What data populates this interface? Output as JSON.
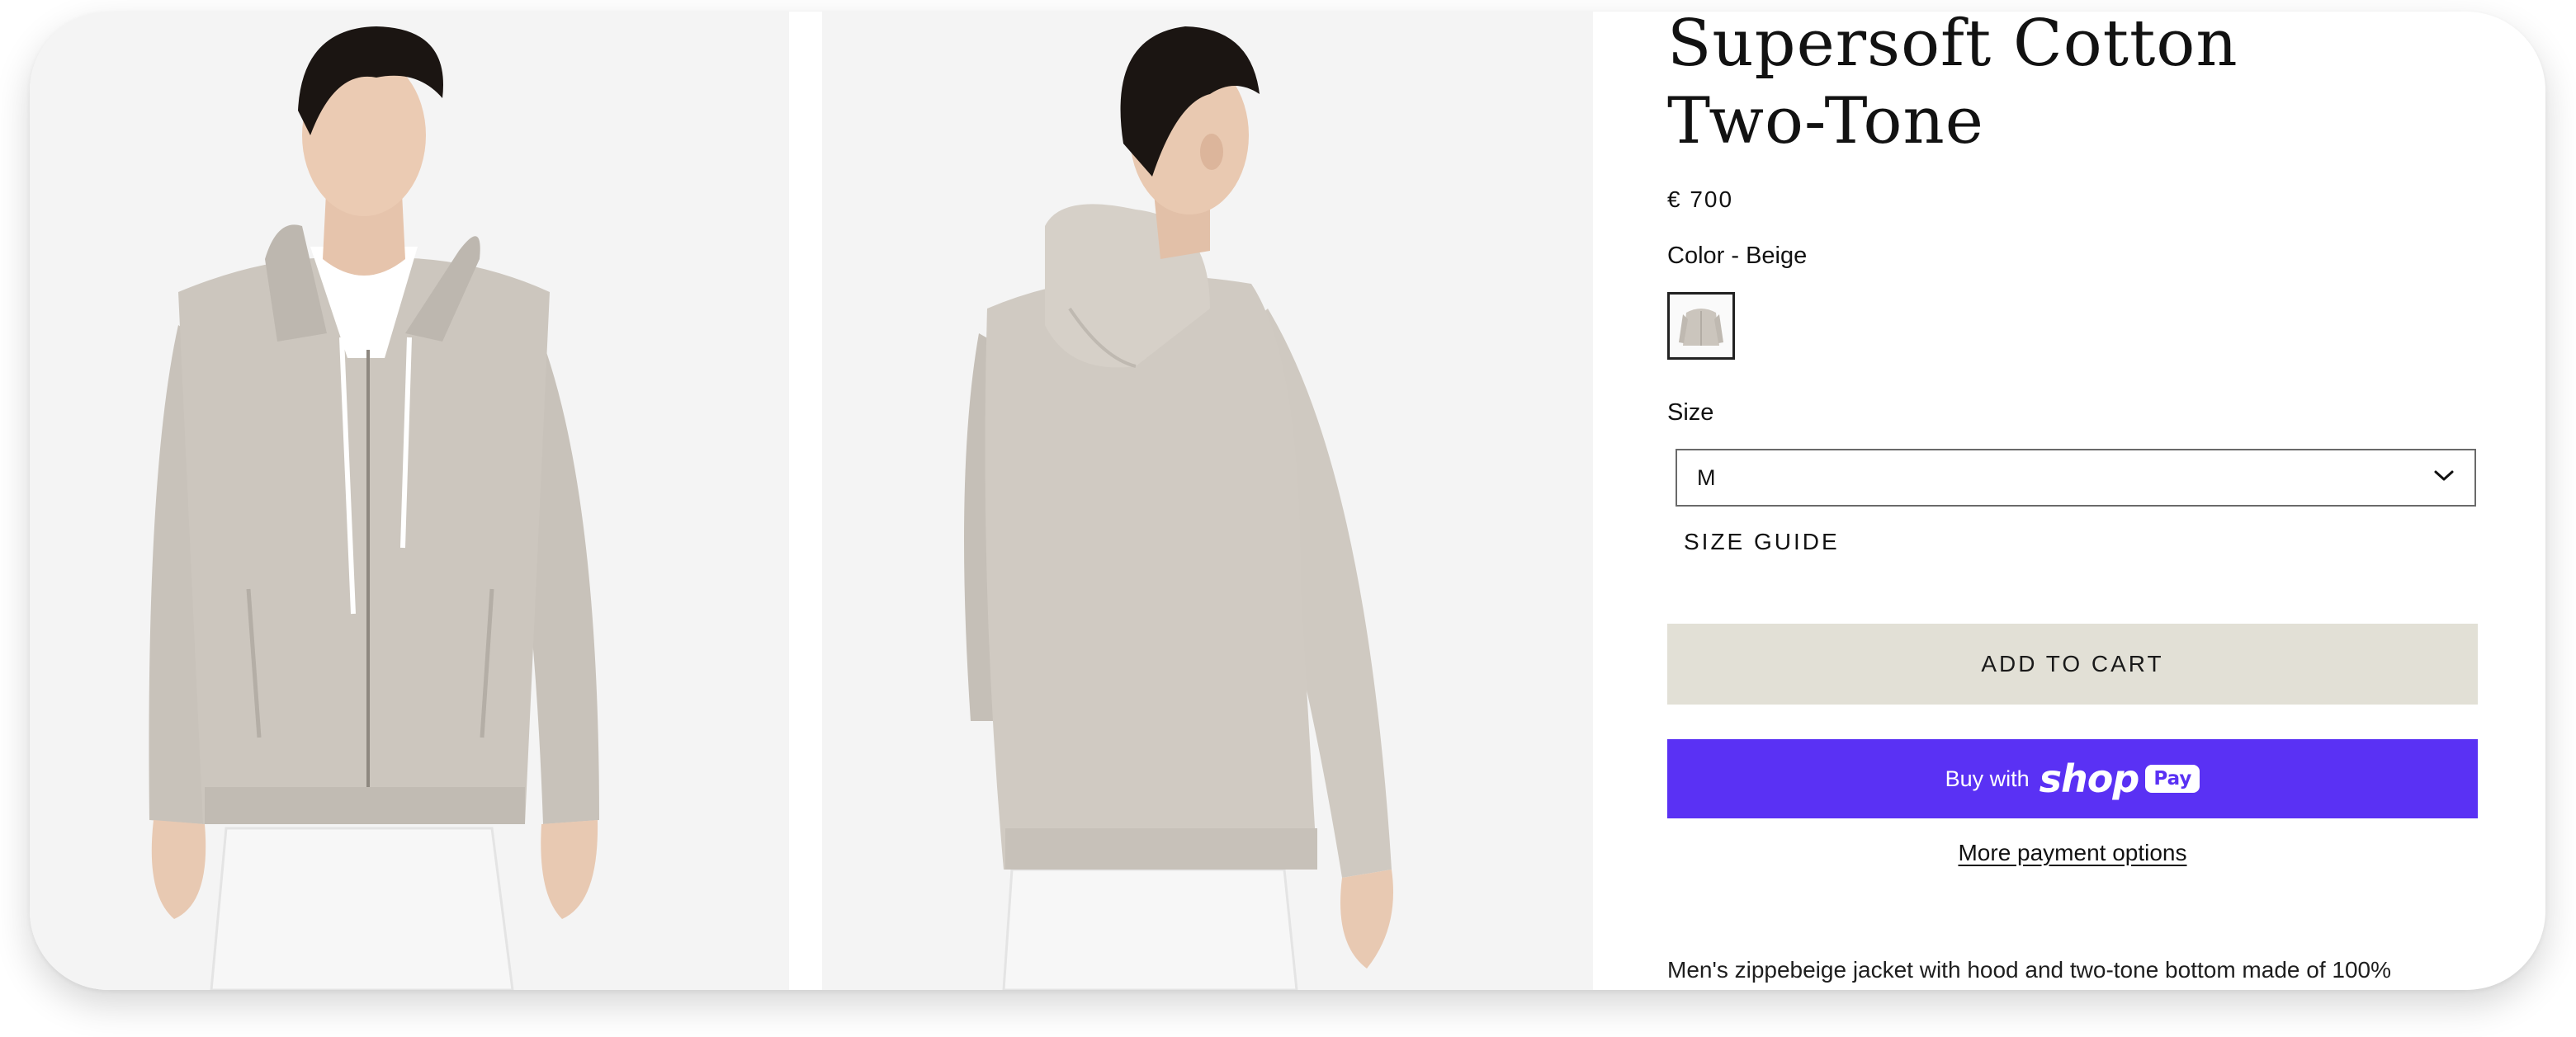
{
  "product": {
    "title": "Supersoft Cotton Two-Tone",
    "price": "€ 700",
    "color_label": "Color - Beige",
    "size_label": "Size",
    "size_selected": "M",
    "size_guide_label": "SIZE GUIDE",
    "description": "Men's zippebeige jacket with hood and two-tone bottom made of 100%"
  },
  "buttons": {
    "add_to_cart": "ADD TO CART",
    "buy_with": "Buy with",
    "shop_word": "shop",
    "pay_badge": "Pay",
    "more_payment_options": "More payment options"
  },
  "icons": {
    "size_dropdown": "chevron-down-icon"
  },
  "colors": {
    "garment_beige": "#cbc5bd",
    "add_to_cart_bg": "#e2e0d6",
    "shop_pay_purple": "#5a31f4",
    "photo_background": "#f4f4f4"
  }
}
